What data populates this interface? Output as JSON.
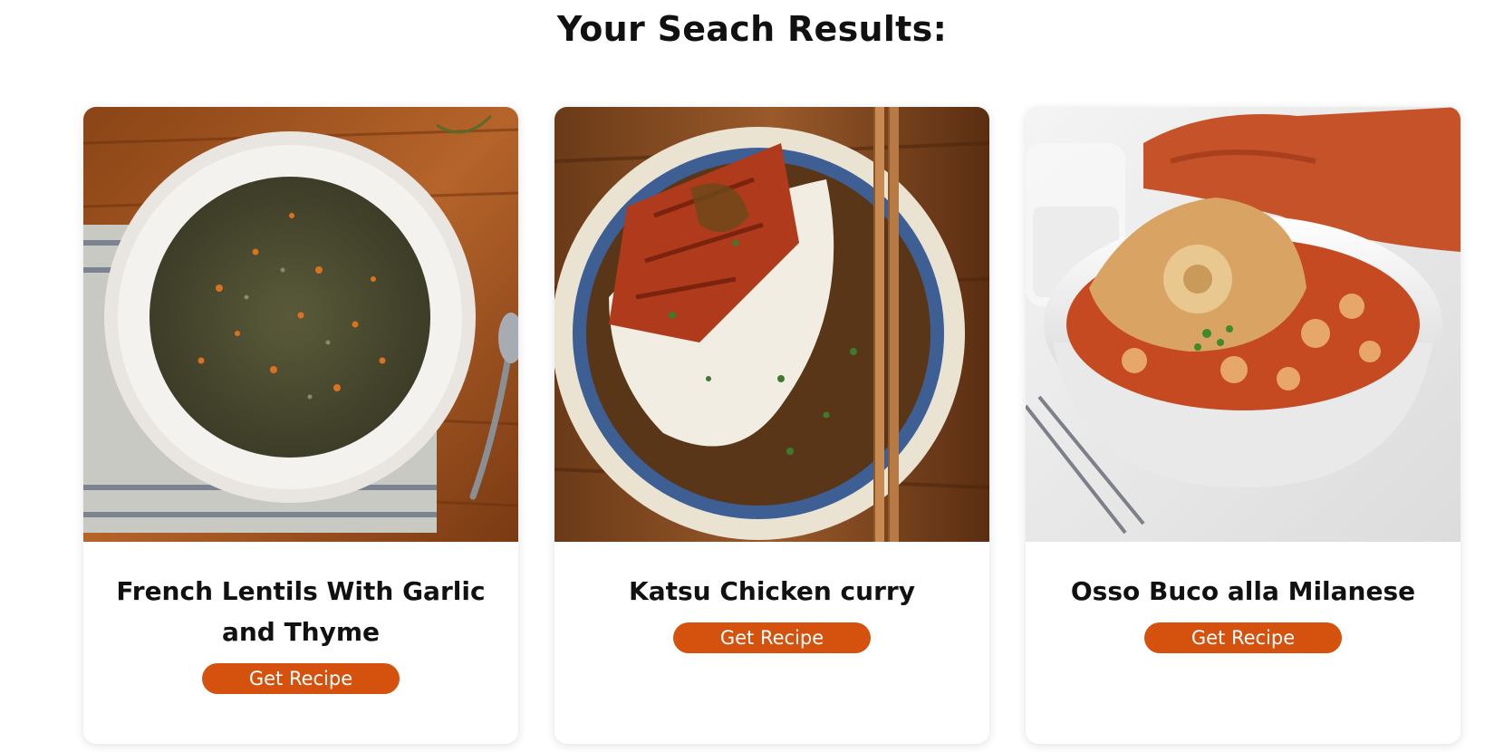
{
  "header": {
    "title": "Your Seach Results:"
  },
  "recipes": [
    {
      "title": "French Lentils With Garlic and Thyme",
      "button_label": "Get Recipe",
      "image": "lentils-bowl-photo"
    },
    {
      "title": "Katsu Chicken curry",
      "button_label": "Get Recipe",
      "image": "katsu-curry-photo"
    },
    {
      "title": "Osso Buco alla Milanese",
      "button_label": "Get Recipe",
      "image": "osso-buco-photo"
    }
  ],
  "colors": {
    "accent": "#d4520e",
    "title_text": "#111111"
  }
}
